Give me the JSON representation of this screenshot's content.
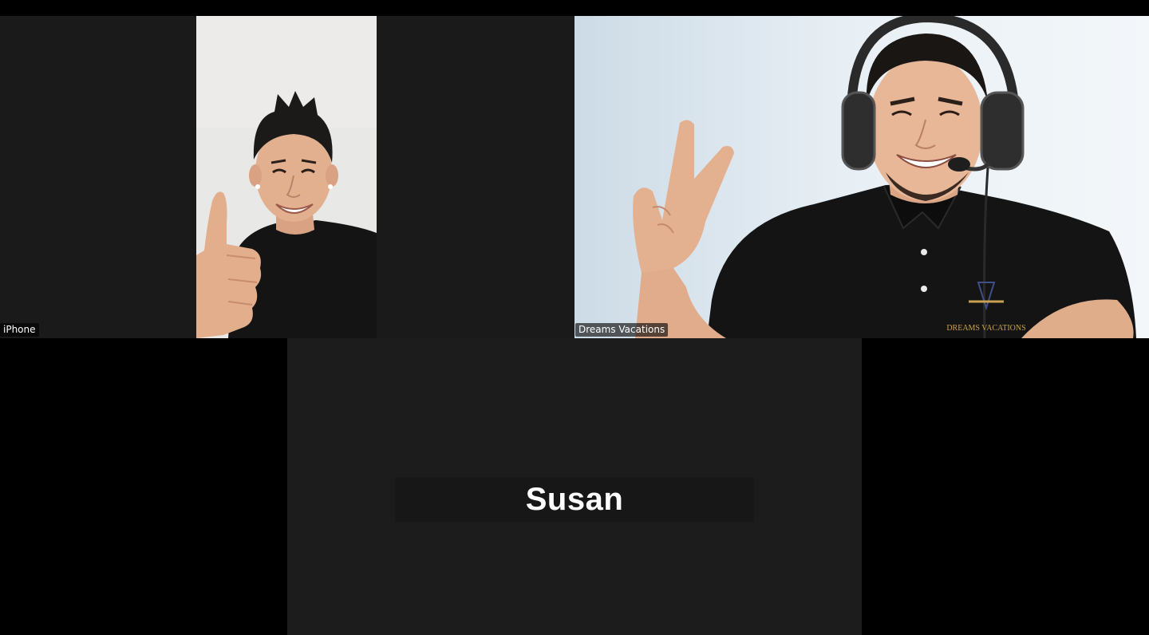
{
  "meeting": {
    "participants": [
      {
        "name": "iPhone",
        "video_on": true
      },
      {
        "name": "Dreams Vacations",
        "video_on": true
      },
      {
        "name": "Susan",
        "video_on": false
      }
    ]
  },
  "shirt_logo_text": "DREAMS VACATIONS"
}
